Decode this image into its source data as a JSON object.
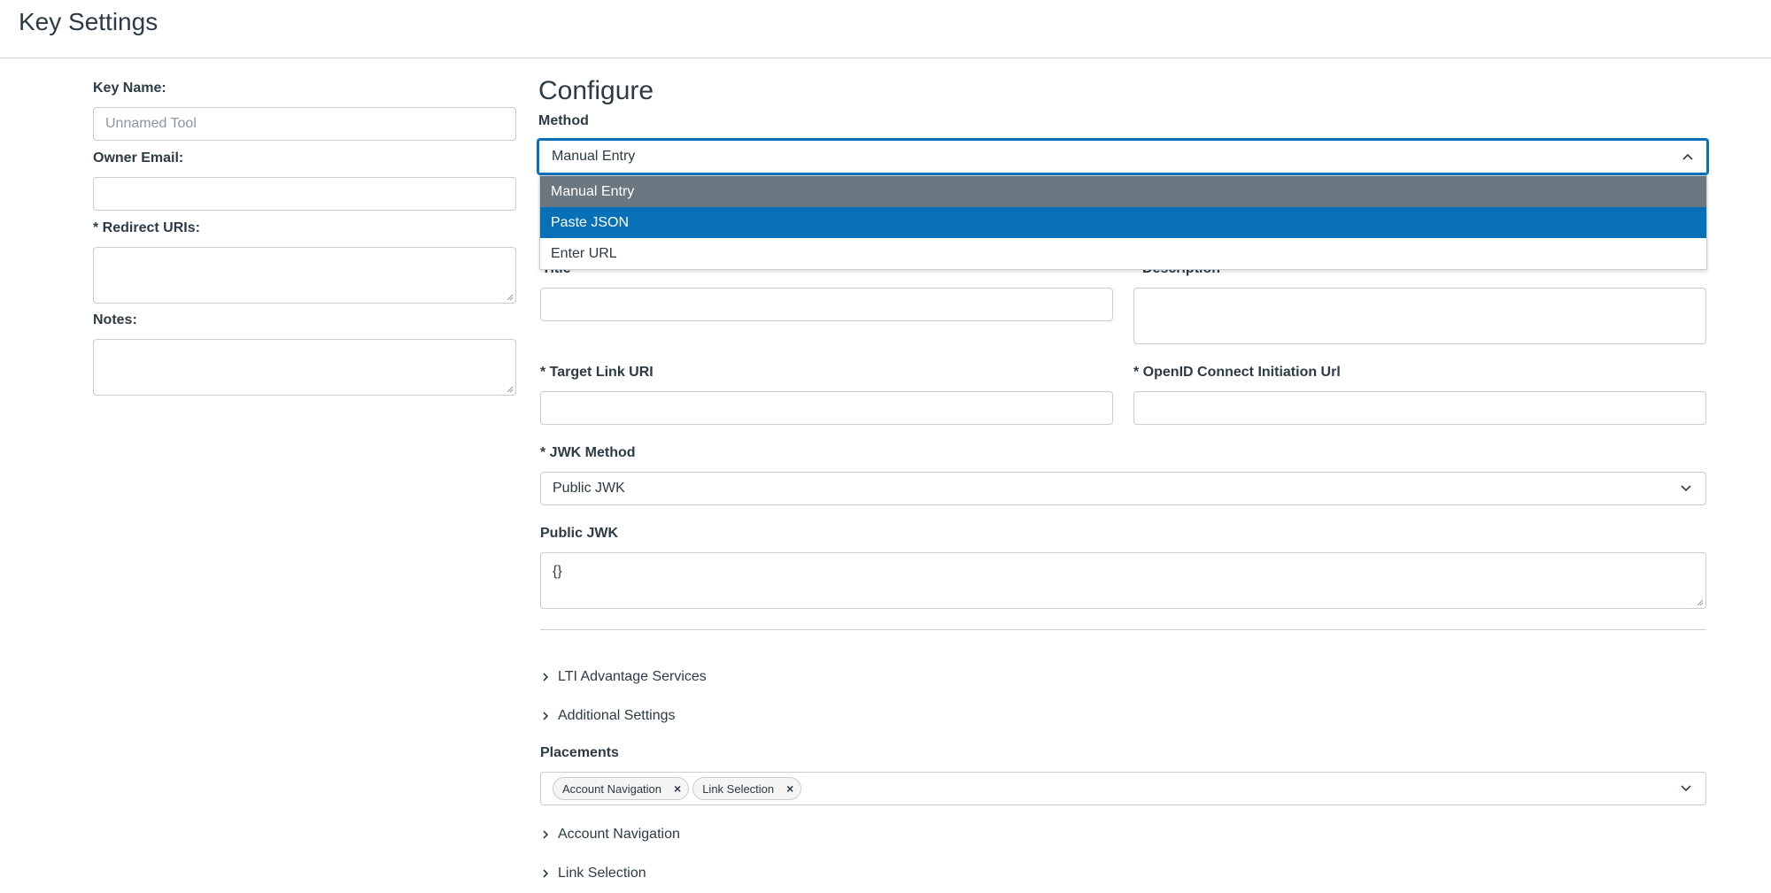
{
  "header": {
    "title": "Key Settings"
  },
  "key_settings": {
    "key_name": {
      "label": "Key Name:",
      "placeholder": "Unnamed Tool",
      "value": ""
    },
    "owner_email": {
      "label": "Owner Email:",
      "value": ""
    },
    "redirect_uris": {
      "label": "* Redirect URIs:",
      "value": ""
    },
    "notes": {
      "label": "Notes:",
      "value": ""
    }
  },
  "configure": {
    "title": "Configure",
    "method": {
      "label": "Method",
      "value": "Manual Entry",
      "options": [
        "Manual Entry",
        "Paste JSON",
        "Enter URL"
      ],
      "hovered_option": "Manual Entry",
      "highlighted_option": "Paste JSON"
    },
    "title_field": {
      "label": "Title",
      "value": ""
    },
    "description_field": {
      "label": "Description",
      "value": ""
    },
    "target_link_uri": {
      "label": "* Target Link URI",
      "value": ""
    },
    "openid_url": {
      "label": "* OpenID Connect Initiation Url",
      "value": ""
    },
    "jwk_method": {
      "label": "* JWK Method",
      "value": "Public JWK"
    },
    "public_jwk": {
      "label": "Public JWK",
      "value": "{}"
    },
    "lti_advantage": {
      "label": "LTI Advantage Services"
    },
    "additional_settings": {
      "label": "Additional Settings"
    },
    "placements": {
      "label": "Placements",
      "chips": [
        "Account Navigation",
        "Link Selection"
      ]
    },
    "account_navigation": {
      "label": "Account Navigation"
    },
    "link_selection": {
      "label": "Link Selection"
    }
  },
  "colors": {
    "accent": "#0770b7",
    "hover": "#6b7780",
    "border": "#c7cdd1",
    "text": "#2d3b45"
  }
}
